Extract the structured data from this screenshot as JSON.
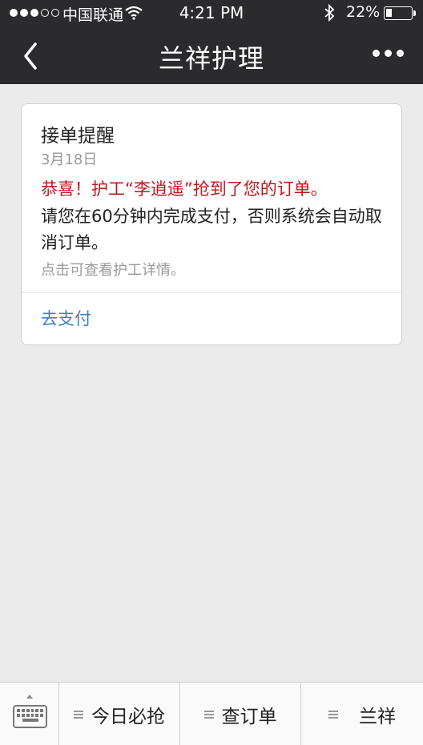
{
  "status_bar": {
    "carrier": "中国联通",
    "time": "4:21 PM",
    "battery_percent": "22%",
    "battery_level": 0.22,
    "signal_bars": 3,
    "signal_total": 5
  },
  "nav": {
    "title": "兰祥护理",
    "back_icon": "chevron-left-icon",
    "more_icon": "more-dots-icon"
  },
  "card": {
    "title": "接单提醒",
    "date": "3月18日",
    "highlight": "恭喜！护工“李逍遥”抢到了您的订单。",
    "body": "请您在60分钟内完成支付，否则系统会自动取消订单。",
    "hint": "点击可查看护工详情。",
    "action_label": "去支付"
  },
  "bottom_bar": {
    "keyboard_icon": "keyboard-icon",
    "menus": [
      {
        "label": "今日必抢"
      },
      {
        "label": "查订单"
      },
      {
        "label": "兰祥"
      }
    ]
  },
  "colors": {
    "nav_background": "#2b2b2e",
    "highlight_text": "#c0161a",
    "link_text": "#3a7fc4",
    "page_background": "#ebebeb"
  }
}
